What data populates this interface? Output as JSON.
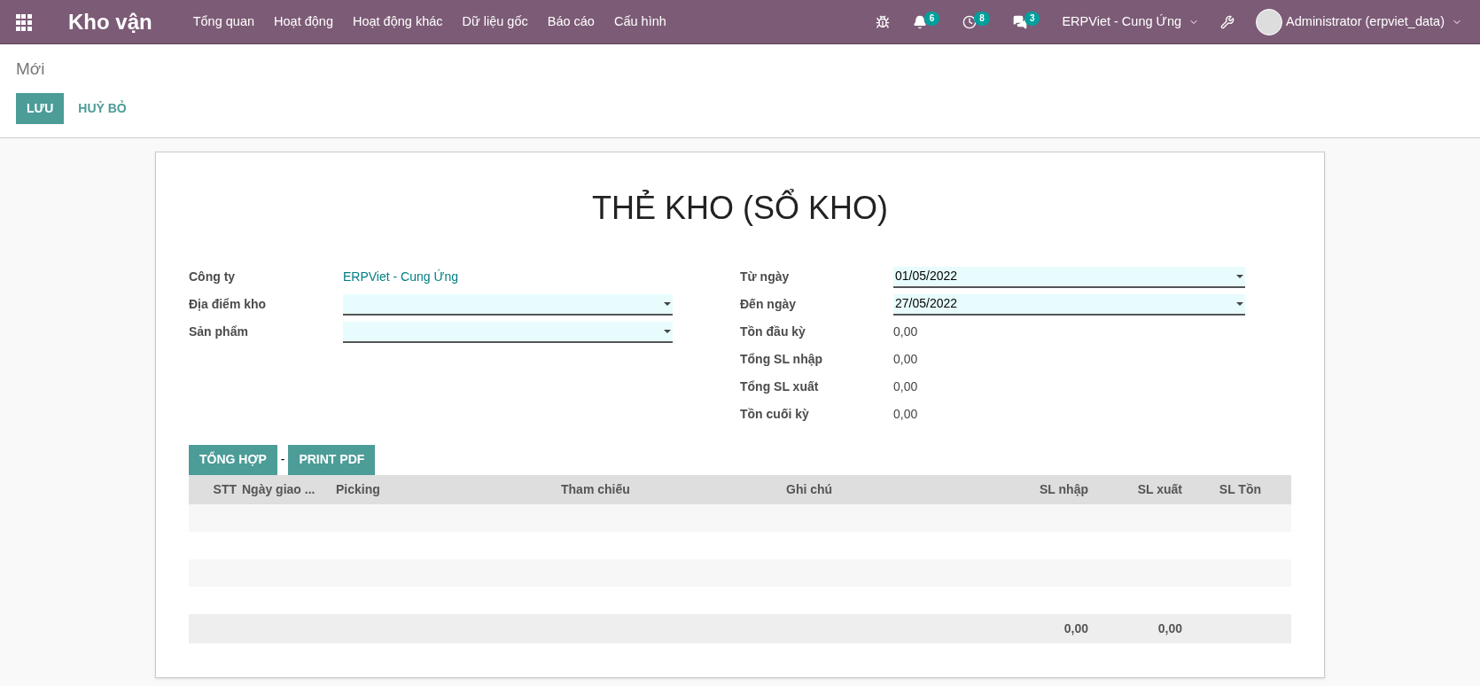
{
  "navbar": {
    "app_title": "Kho vận",
    "menu": [
      "Tổng quan",
      "Hoạt động",
      "Hoạt động khác",
      "Dữ liệu gốc",
      "Báo cáo",
      "Cấu hình"
    ],
    "systray": [
      {
        "kind": "bug"
      },
      {
        "kind": "bell",
        "count": "6"
      },
      {
        "kind": "clock",
        "count": "8"
      },
      {
        "kind": "chat",
        "count": "3"
      }
    ],
    "company": "ERPViet - Cung Ứng",
    "user": "Administrator (erpviet_data)"
  },
  "control_panel": {
    "breadcrumb": "Mới",
    "buttons": [
      {
        "label": "LƯU",
        "kind": "primary"
      },
      {
        "label": "HUỶ BỎ",
        "kind": "secondary"
      }
    ]
  },
  "form": {
    "title": "THẺ KHO (SỔ KHO)",
    "left_fields": [
      {
        "label": "Công ty",
        "kind": "link",
        "value": "ERPViet - Cung Ứng"
      },
      {
        "label": "Địa điểm kho",
        "kind": "select"
      },
      {
        "label": "Sản phẩm",
        "kind": "select"
      }
    ],
    "right_fields": [
      {
        "label": "Từ ngày",
        "kind": "select",
        "value": "01/05/2022"
      },
      {
        "label": "Đến ngày",
        "kind": "select",
        "value": "27/05/2022"
      },
      {
        "label": "Tồn đầu kỳ",
        "kind": "text",
        "value": "0,00"
      },
      {
        "label": "Tổng SL nhập",
        "kind": "text",
        "value": "0,00"
      },
      {
        "label": "Tổng SL xuất",
        "kind": "text",
        "value": "0,00"
      },
      {
        "label": "Tồn cuối kỳ",
        "kind": "text",
        "value": "0,00"
      }
    ],
    "actions": [
      "TỔNG HỢP",
      "-",
      "PRINT PDF"
    ],
    "table": {
      "columns": [
        "STT",
        "Ngày giao ...",
        "Picking",
        "Tham chiếu",
        "Ghi chú",
        "SL nhập",
        "SL xuất",
        "SL Tồn"
      ],
      "totals": {
        "sl_nhap": "0,00",
        "sl_xuat": "0,00"
      }
    }
  }
}
